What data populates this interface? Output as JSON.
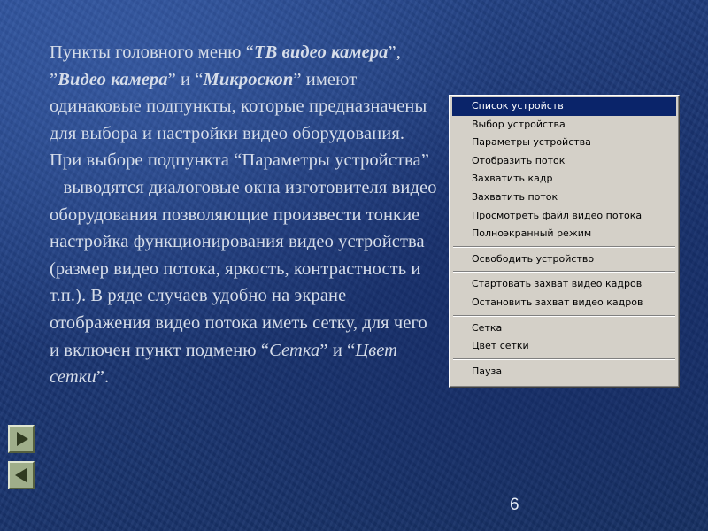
{
  "slide": {
    "text_parts": {
      "p1": "Пункты головного меню “",
      "p2": "ТВ видео камера",
      "p3": "”, ”",
      "p4": "Видео камера",
      "p5": "” и “",
      "p6": "Микроскоп",
      "p7": "” имеют одинаковые подпункты, которые предназначены для выбора и настройки видео оборудования. При выборе подпункта “Параметры устройства” – выводятся диалоговые окна изготовителя видео оборудования позволяющие произвести тонкие настройка функционирования видео устройства (размер видео потока,  яркость, контрастность и т.п.). В ряде случаев удобно на экране отображения видео потока иметь сетку, для чего и включен пункт подменю “",
      "p8": "Сетка",
      "p9": "” и “",
      "p10": "Цвет сетки",
      "p11": "”."
    },
    "page_number": "6"
  },
  "menu": {
    "selected_index": 0,
    "groups": [
      [
        "Список устройств",
        "Выбор устройства",
        "Параметры устройства",
        "Отобразить поток",
        "Захватить кадр",
        "Захватить поток",
        "Просмотреть файл видео потока",
        "Полноэкранный режим"
      ],
      [
        "Освободить устройство"
      ],
      [
        "Стартовать захват видео кадров",
        "Остановить захват видео кадров"
      ],
      [
        "Сетка",
        "Цвет сетки"
      ],
      [
        "Пауза"
      ]
    ]
  },
  "nav": {
    "next_icon": "triangle-right-icon",
    "prev_icon": "triangle-left-icon",
    "button_color": "#9fae8a"
  },
  "colors": {
    "background": "#1c3a78",
    "text": "#d6dde9",
    "menu_bg": "#d4d0c8",
    "menu_selected": "#0a246a"
  }
}
